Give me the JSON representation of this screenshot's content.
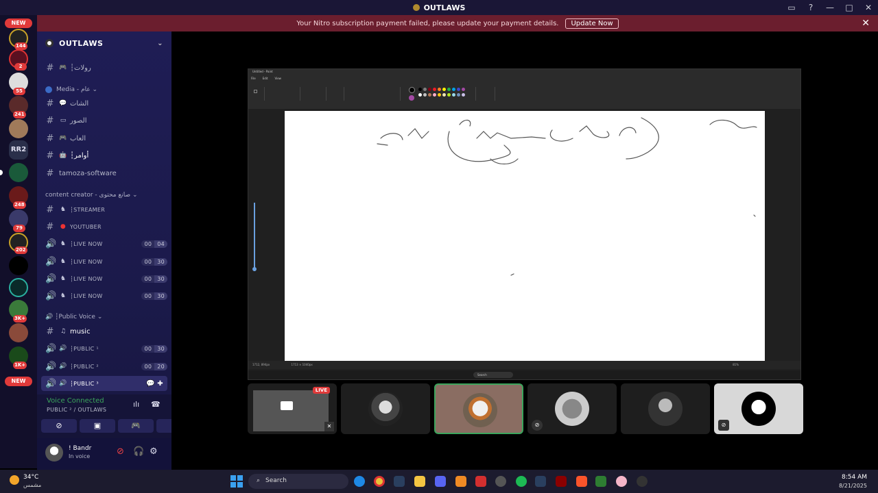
{
  "titlebar": {
    "title": "OUTLAWS",
    "icons": [
      "inbox-icon",
      "help-icon",
      "minimize-icon",
      "maximize-icon",
      "close-icon"
    ],
    "win_glyphs": [
      "▭",
      "?",
      "—",
      "□",
      "✕"
    ]
  },
  "nitro": {
    "message": "Your Nitro subscription payment failed, please update your payment details.",
    "button": "Update Now",
    "close": "✕"
  },
  "servers": {
    "new_top": "NEW",
    "new_bottom": "NEW",
    "rr2": "RR2",
    "badges": [
      "144",
      "2",
      "55",
      "241",
      "248",
      "79",
      "202",
      "3K+",
      "1K+"
    ]
  },
  "guild": {
    "name": "OUTLAWS"
  },
  "channels": {
    "rolat": "رولات",
    "cat_media": "Media - عام",
    "chat": "الشات",
    "photos": "الصور",
    "games": "العاب",
    "orders": "أوامر",
    "tamoza": "tamoza-software",
    "cat_creator": "content creator - صانع محتوى",
    "streamer": "STREAMER",
    "youtuber": "YOUTUBER",
    "live_now": "LIVE NOW",
    "live_counts": [
      [
        "00",
        "04"
      ],
      [
        "00",
        "30"
      ],
      [
        "00",
        "30"
      ],
      [
        "00",
        "30"
      ]
    ],
    "cat_public": "Public Voice",
    "music": "music",
    "public1": "PUBLIC ¹",
    "public2": "PUBLIC ²",
    "public3": "PUBLIC ³",
    "public_counts": [
      [
        "00",
        "30"
      ],
      [
        "00",
        "20"
      ]
    ],
    "separator": "┆"
  },
  "voice": {
    "status": "Voice Connected",
    "channel": "PUBLIC ² / OUTLAWS"
  },
  "user": {
    "name": "! Bandr",
    "status": "In voice"
  },
  "paint": {
    "title": "Untitled - Paint",
    "menu": [
      "File",
      "Edit",
      "View"
    ],
    "groups": [
      "Selection",
      "Image",
      "Tools",
      "Brushes",
      "Shapes",
      "Colors",
      "Copilot",
      "Layers"
    ],
    "status_left": "1712, 894px",
    "status_mid": "1713 × 1040px",
    "zoom": "81%",
    "search": "Search",
    "swatch_colors": [
      "#000000",
      "#7f7f7f",
      "#880015",
      "#ed1c24",
      "#ff7f27",
      "#fff200",
      "#22b14c",
      "#00a2e8",
      "#3f48cc",
      "#a349a4",
      "#ffffff",
      "#c3c3c3",
      "#b97a57",
      "#ffaec9",
      "#ffc90e",
      "#efe4b0",
      "#b5e61d",
      "#99d9ea",
      "#7092be",
      "#c8bfe7"
    ]
  },
  "stage": {
    "live_badge": "LIVE"
  },
  "taskbar": {
    "temp": "34°C",
    "weather": "مشمس",
    "search": "Search",
    "time": "8:54 AM",
    "date": "8/21/2025"
  }
}
